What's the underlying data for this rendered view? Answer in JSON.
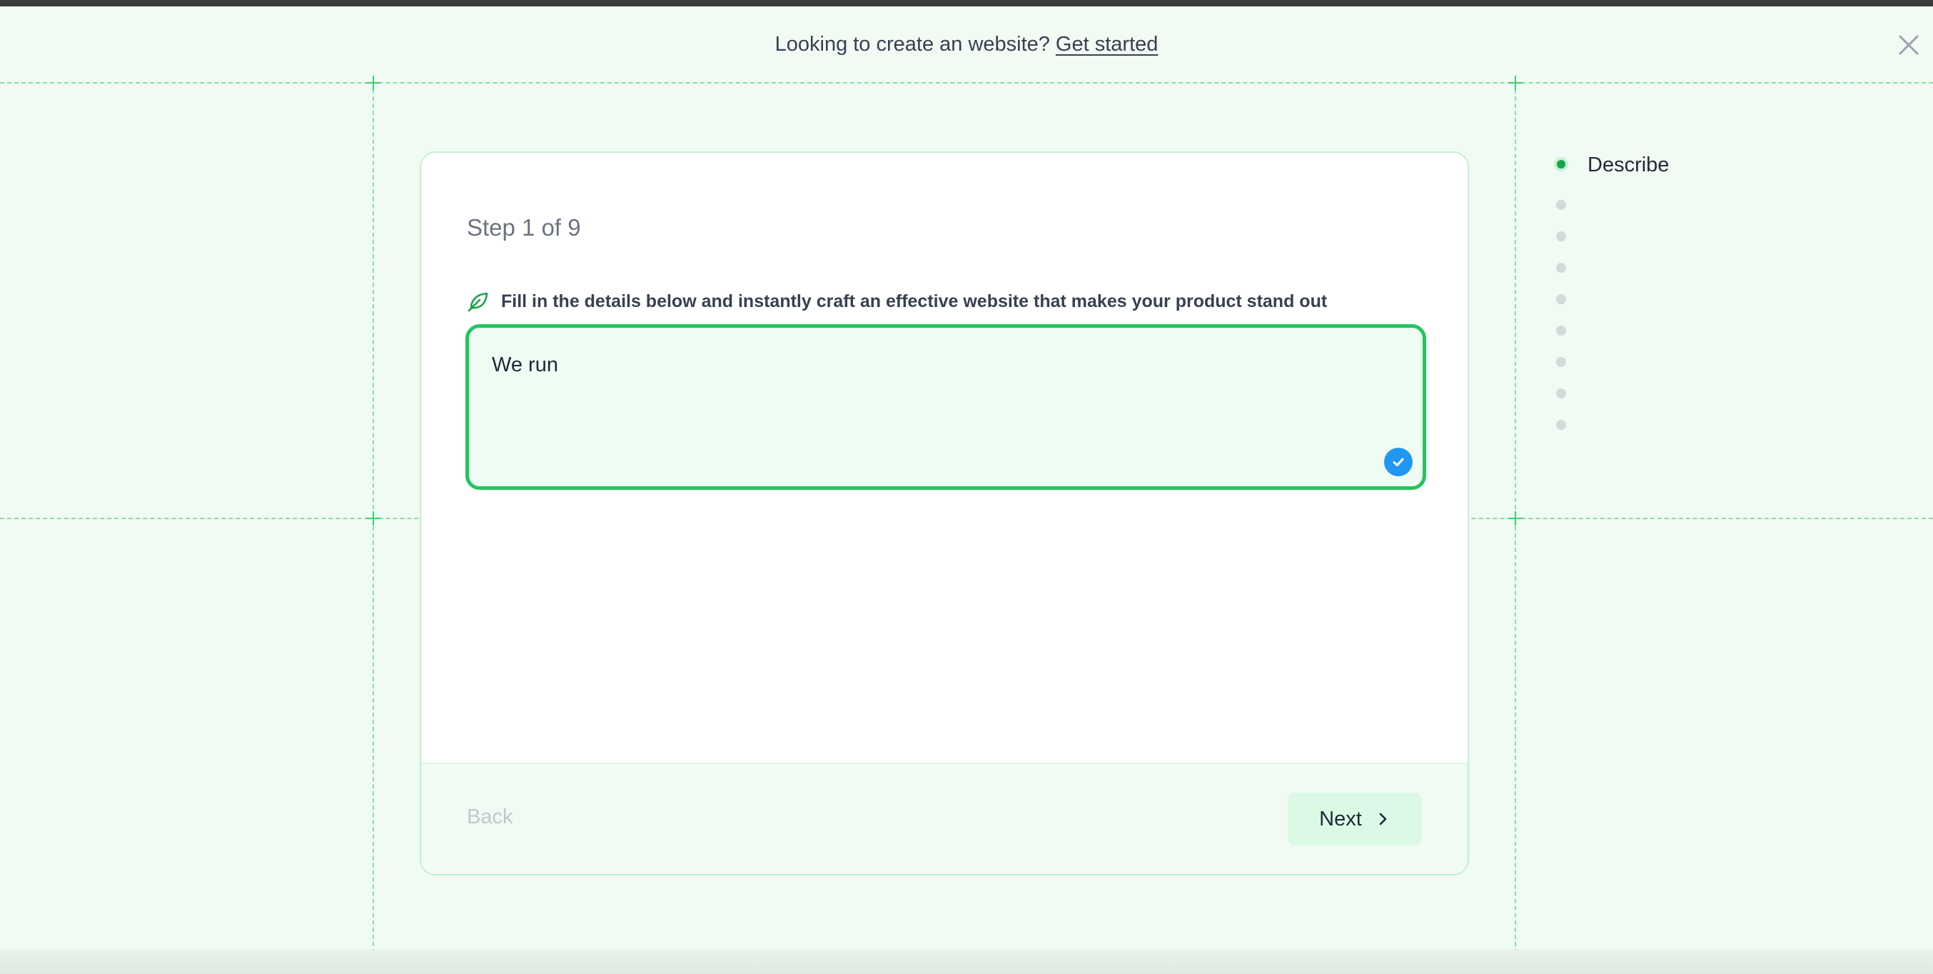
{
  "banner": {
    "message": "Looking to create an website?",
    "link": "Get started"
  },
  "wizard": {
    "step_text": "Step 1 of 9",
    "hint": "Fill in the details below and instantly craft an effective website that makes your product stand out",
    "description_value": "We run",
    "back_label": "Back",
    "next_label": "Next"
  },
  "stepper": {
    "active_label": "Describe",
    "current_step": 1,
    "total_steps": 9
  },
  "colors": {
    "accent": "#22c55e",
    "badge": "#2196f3"
  },
  "icons": [
    "close-icon",
    "leaf-icon",
    "check-icon",
    "chevron-right-icon"
  ]
}
